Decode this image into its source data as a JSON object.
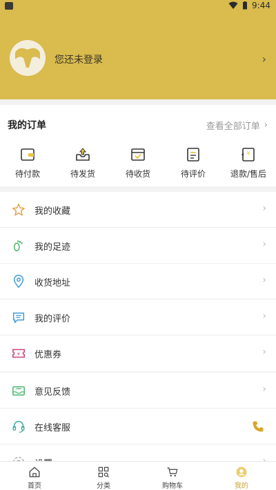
{
  "status": {
    "time": "9:44"
  },
  "header": {
    "login_prompt": "您还未登录"
  },
  "orders": {
    "title": "我的订单",
    "view_all": "查看全部订单",
    "items": [
      {
        "label": "待付款",
        "icon": "wallet-icon"
      },
      {
        "label": "待发货",
        "icon": "box-upload-icon"
      },
      {
        "label": "待收货",
        "icon": "package-check-icon"
      },
      {
        "label": "待评价",
        "icon": "document-icon"
      },
      {
        "label": "退款/售后",
        "icon": "refund-icon"
      }
    ]
  },
  "menu1": [
    {
      "label": "我的收藏",
      "icon": "star-icon"
    },
    {
      "label": "我的足迹",
      "icon": "footprint-icon"
    },
    {
      "label": "收货地址",
      "icon": "location-icon"
    },
    {
      "label": "我的评价",
      "icon": "comment-icon"
    },
    {
      "label": "优惠券",
      "icon": "coupon-icon"
    }
  ],
  "menu2": [
    {
      "label": "意见反馈",
      "icon": "feedback-icon"
    },
    {
      "label": "在线客服",
      "icon": "headset-icon"
    },
    {
      "label": "设置",
      "icon": "gear-icon"
    }
  ],
  "tabbar": [
    {
      "label": "首页",
      "icon": "home-icon"
    },
    {
      "label": "分类",
      "icon": "category-icon"
    },
    {
      "label": "购物车",
      "icon": "cart-icon"
    },
    {
      "label": "我的",
      "icon": "profile-icon"
    }
  ],
  "colors": {
    "brand": "#d9bb4e",
    "accent_active": "#c7a43a",
    "phone": "#d9a62a"
  }
}
